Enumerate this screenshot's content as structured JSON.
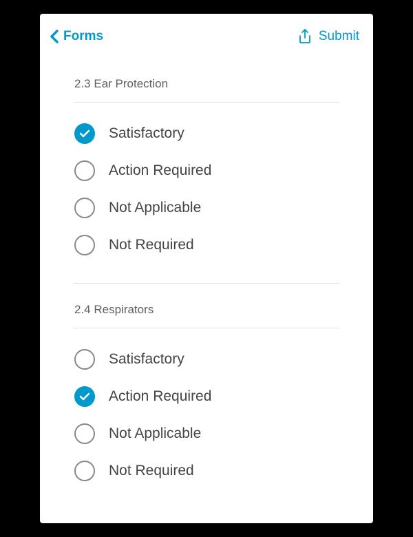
{
  "header": {
    "back_label": "Forms",
    "submit_label": "Submit"
  },
  "sections": [
    {
      "title": "2.3 Ear Protection",
      "options": [
        {
          "label": "Satisfactory",
          "selected": true
        },
        {
          "label": "Action Required",
          "selected": false
        },
        {
          "label": "Not Applicable",
          "selected": false
        },
        {
          "label": "Not Required",
          "selected": false
        }
      ]
    },
    {
      "title": "2.4 Respirators",
      "options": [
        {
          "label": "Satisfactory",
          "selected": false
        },
        {
          "label": "Action Required",
          "selected": true
        },
        {
          "label": "Not Applicable",
          "selected": false
        },
        {
          "label": "Not Required",
          "selected": false
        }
      ]
    }
  ],
  "colors": {
    "accent": "#0099CC"
  }
}
